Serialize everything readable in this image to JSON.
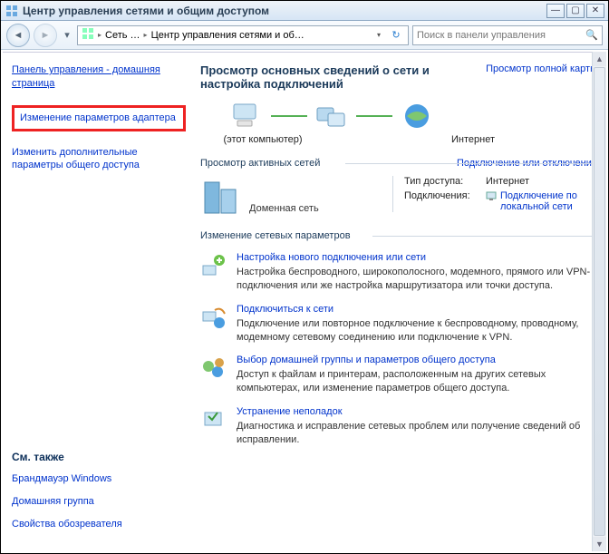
{
  "window": {
    "title": "Центр управления сетями и общим доступом"
  },
  "breadcrumb": {
    "p1": "Сеть …",
    "p2": "Центр управления сетями и об…"
  },
  "search": {
    "placeholder": "Поиск в панели управления"
  },
  "sidebar": {
    "home": "Панель управления - домашняя страница",
    "adapter": "Изменение параметров адаптера",
    "advanced": "Изменить дополнительные параметры общего доступа",
    "see_also_title": "См. также",
    "firewall": "Брандмауэр Windows",
    "homegroup": "Домашняя группа",
    "inetopt": "Свойства обозревателя"
  },
  "main": {
    "heading": "Просмотр основных сведений о сети и настройка подключений",
    "fullmap": "Просмотр полной карты",
    "cap_pc": "(этот компьютер)",
    "cap_mid": "",
    "cap_net": "Интернет",
    "sec_active": "Просмотр активных сетей",
    "toggle": "Подключение или отключение",
    "net_name": "Доменная сеть",
    "access_lbl": "Тип доступа:",
    "access_val": "Интернет",
    "conn_lbl": "Подключения:",
    "conn_val": "Подключение по локальной сети",
    "sec_params": "Изменение сетевых параметров",
    "items": [
      {
        "title": "Настройка нового подключения или сети",
        "desc": "Настройка беспроводного, широкополосного, модемного, прямого или VPN-подключения или же настройка маршрутизатора или точки доступа."
      },
      {
        "title": "Подключиться к сети",
        "desc": "Подключение или повторное подключение к беспроводному, проводному, модемному сетевому соединению или подключение к VPN."
      },
      {
        "title": "Выбор домашней группы и параметров общего доступа",
        "desc": "Доступ к файлам и принтерам, расположенным на других сетевых компьютерах, или изменение параметров общего доступа."
      },
      {
        "title": "Устранение неполадок",
        "desc": "Диагностика и исправление сетевых проблем или получение сведений об исправлении."
      }
    ]
  }
}
